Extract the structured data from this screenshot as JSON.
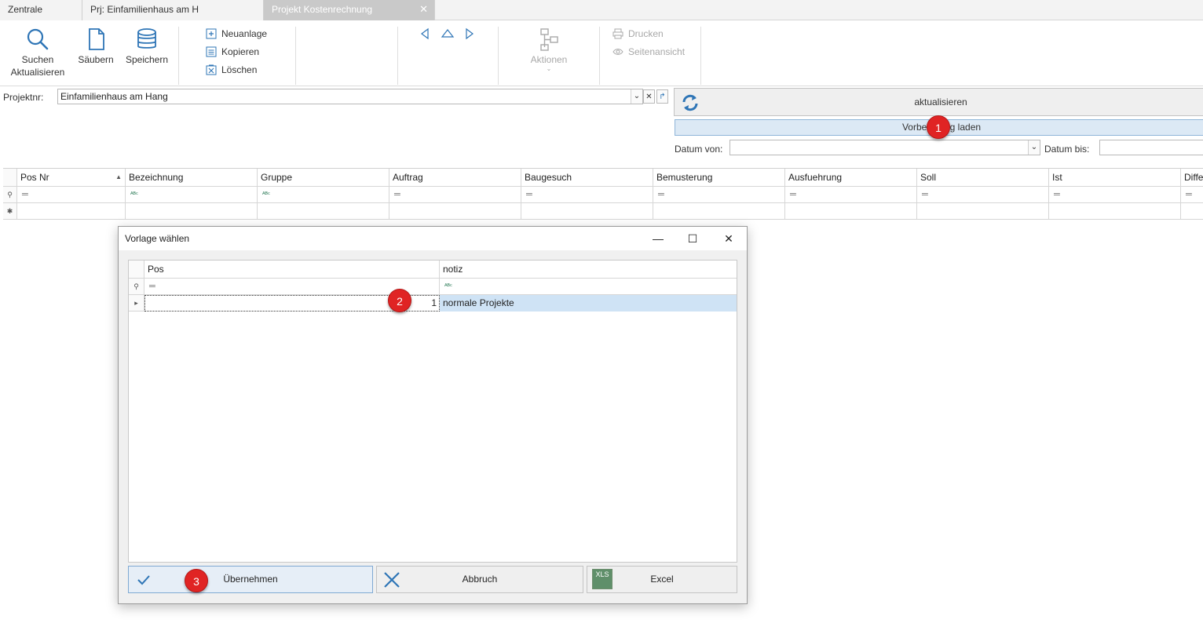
{
  "tabs": [
    {
      "label": "Zentrale",
      "active": false
    },
    {
      "label": "Prj: Einfamilienhaus am H",
      "active": false
    },
    {
      "label": "Projekt Kostenrechnung",
      "active": true,
      "close": "✕"
    }
  ],
  "ribbon": {
    "search_label_1": "Suchen",
    "search_label_2": "Aktualisieren",
    "clear_label": "Säubern",
    "save_label": "Speichern",
    "new_label": "Neuanlage",
    "copy_label": "Kopieren",
    "delete_label": "Löschen",
    "actions_label": "Aktionen",
    "print_label": "Drucken",
    "preview_label": "Seitenansicht"
  },
  "project": {
    "label": "Projektnr:",
    "value": "Einfamilienhaus am Hang"
  },
  "buttons": {
    "refresh_label": "aktualisieren",
    "load_defaults_label": "Vorbelegung laden"
  },
  "dates": {
    "from_label": "Datum von:",
    "to_label": "Datum bis:"
  },
  "main_grid": {
    "columns": [
      "Pos Nr",
      "Bezeichnung",
      "Gruppe",
      "Auftrag",
      "Baugesuch",
      "Bemusterung",
      "Ausfuehrung",
      "Soll",
      "Ist",
      "Diffe"
    ]
  },
  "dialog": {
    "title": "Vorlage wählen",
    "columns": [
      "Pos",
      "notiz"
    ],
    "row": {
      "pos": "1",
      "notiz": "normale Projekte"
    },
    "ok_label": "Übernehmen",
    "cancel_label": "Abbruch",
    "excel_label": "Excel",
    "excel_icon_text": "XLS"
  },
  "markers": [
    "1",
    "2",
    "3"
  ],
  "colors": {
    "accent": "#2e75b6",
    "marker": "#e02424",
    "selected_row": "#cfe3f5"
  }
}
